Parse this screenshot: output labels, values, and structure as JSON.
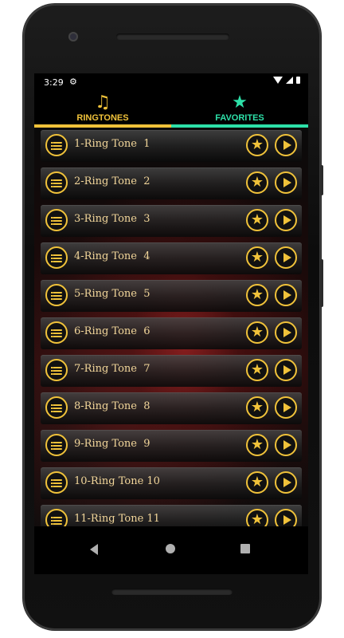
{
  "status": {
    "time": "3:29"
  },
  "tabs": [
    {
      "label": "RINGTONES",
      "icon": "music-note-icon",
      "color": "#f0c23a",
      "underline": "#f0c23a"
    },
    {
      "label": "FAVORITES",
      "icon": "star-icon",
      "color": "#2de0a8",
      "underline": "#2de0a8"
    }
  ],
  "ringtones": [
    {
      "label": "1-Ring Tone  1"
    },
    {
      "label": "2-Ring Tone  2"
    },
    {
      "label": "3-Ring Tone  3"
    },
    {
      "label": "4-Ring Tone  4"
    },
    {
      "label": "5-Ring Tone  5"
    },
    {
      "label": "6-Ring Tone  6"
    },
    {
      "label": "7-Ring Tone  7"
    },
    {
      "label": "8-Ring Tone  8"
    },
    {
      "label": "9-Ring Tone  9"
    },
    {
      "label": "10-Ring Tone 10"
    },
    {
      "label": "11-Ring Tone 11"
    }
  ],
  "colors": {
    "accent_gold": "#f0c23a",
    "accent_teal": "#2de0a8",
    "label_text": "#f2d69a"
  }
}
